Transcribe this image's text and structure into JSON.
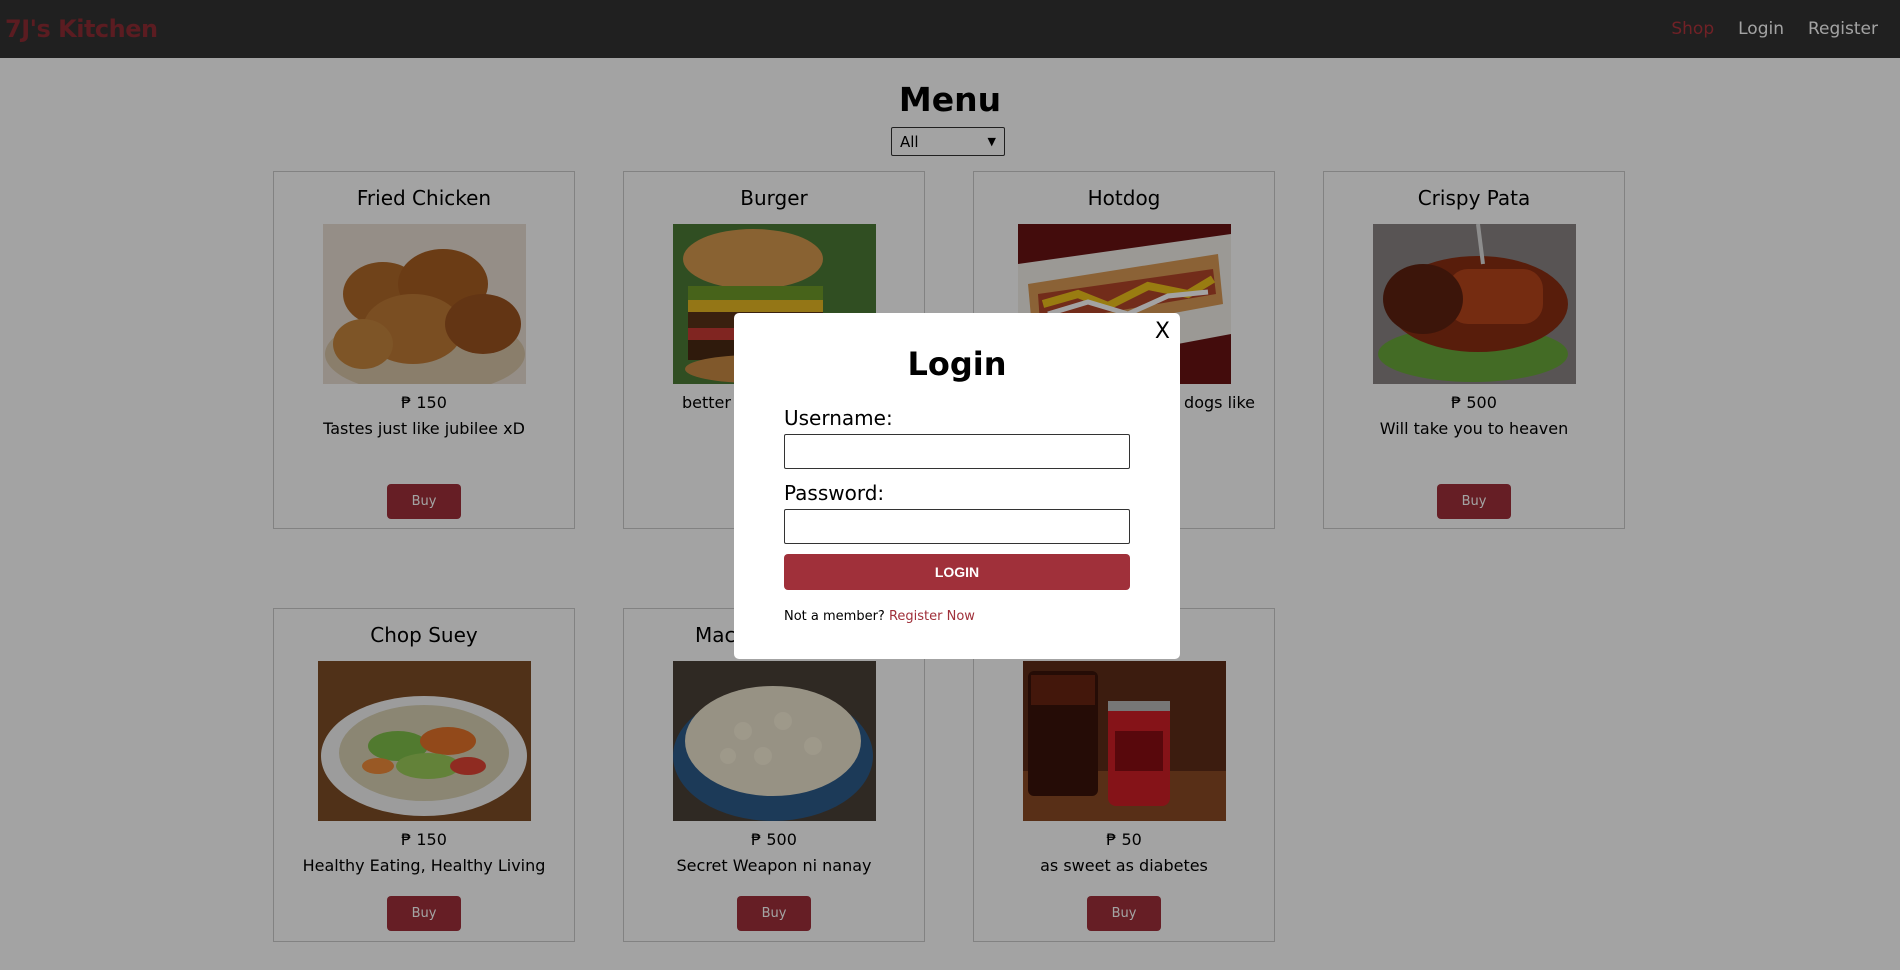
{
  "nav": {
    "brand": "7J's Kitchen",
    "links": [
      "Shop",
      "Login",
      "Register"
    ]
  },
  "main": {
    "title": "Menu",
    "filter_value": "All"
  },
  "products": [
    {
      "name": "Fried Chicken",
      "price": "₱ 150",
      "desc": "Tastes just like jubilee xD",
      "buy": "Buy",
      "image": "fried-chicken-photo"
    },
    {
      "name": "Burger",
      "price": "",
      "desc": "better",
      "buy": "",
      "image": "burger-photo"
    },
    {
      "name": "Hotdog",
      "price": "",
      "desc": "dogs like",
      "buy": "",
      "image": "hotdog-photo"
    },
    {
      "name": "Crispy Pata",
      "price": "₱ 500",
      "desc": "Will take you to heaven",
      "buy": "Buy",
      "image": "crispy-pata-photo"
    },
    {
      "name": "Chop Suey",
      "price": "₱ 150",
      "desc": "Healthy Eating, Healthy Living",
      "buy": "Buy",
      "image": "chop-suey-photo"
    },
    {
      "name": "Mac",
      "price": "₱ 500",
      "desc": "Secret Weapon ni nanay",
      "buy": "Buy",
      "image": "macaroni-salad-photo"
    },
    {
      "name": "",
      "price": "₱ 50",
      "desc": "as sweet as diabetes",
      "buy": "Buy",
      "image": "coca-cola-photo"
    }
  ],
  "modal": {
    "close": "X",
    "title": "Login",
    "username_label": "Username:",
    "password_label": "Password:",
    "login_button": "LOGIN",
    "footer_text": "Not a member?",
    "register_link": "Register Now"
  },
  "colors": {
    "navbar": "#333333",
    "accent": "#a0303a",
    "overlay": "rgba(0,0,0,0.36)"
  }
}
